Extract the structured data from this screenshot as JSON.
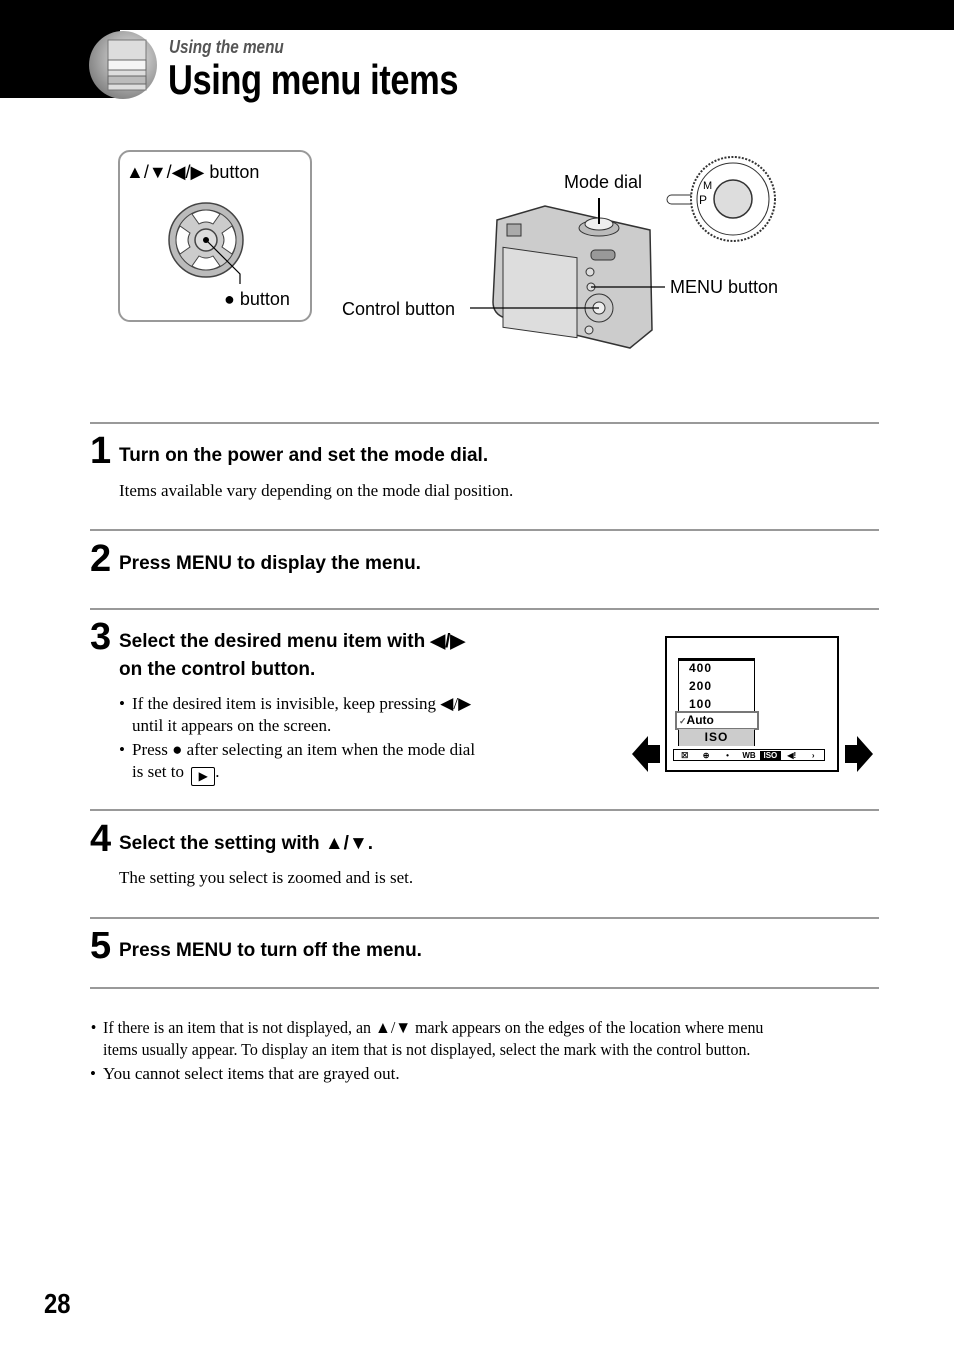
{
  "header": {
    "section": "Using the menu",
    "title": "Using menu items"
  },
  "figure": {
    "control_panel": {
      "arrows_label": "▲/▼/◀/▶ button",
      "center_label": "● button"
    },
    "camera_labels": {
      "mode_dial": "Mode dial",
      "menu_button": "MENU button",
      "control_button": "Control button"
    },
    "mode_dial_marks": [
      "M",
      "P"
    ]
  },
  "steps": [
    {
      "number": "1",
      "heading": "Turn on the power and set the mode dial.",
      "body": "Items available vary depending on the mode dial position."
    },
    {
      "number": "2",
      "heading": "Press MENU to display the menu."
    },
    {
      "number": "3",
      "heading_line1": "Select the desired menu item with ◀/▶",
      "heading_line2": "on the control button.",
      "bullets": [
        {
          "line1": "If the desired item is invisible, keep pressing ◀/▶",
          "line2": "until it appears on the screen."
        },
        {
          "line1": "Press ● after selecting an item when the mode dial",
          "line2_prefix": "is set to",
          "line2_suffix": "."
        }
      ]
    },
    {
      "number": "4",
      "heading": "Select the setting with ▲/▼.",
      "body": "The setting you select is zoomed and is set."
    },
    {
      "number": "5",
      "heading": "Press MENU to turn off the menu."
    }
  ],
  "lcd": {
    "iso_options": [
      "400",
      "200",
      "100"
    ],
    "selected": "Auto",
    "check": "✓",
    "caption": "ISO",
    "menubar": [
      "☒",
      "⊕",
      "•",
      "WB",
      "ISO",
      "◀!",
      "›"
    ]
  },
  "notes": [
    {
      "line1": "If there is an item that is not displayed, an ▲/▼ mark appears on the edges of the location where menu",
      "line2": "items usually appear. To display an item that is not displayed, select the mark with the control button."
    },
    {
      "line1": "You cannot select items that are grayed out."
    }
  ],
  "page_number": "28"
}
